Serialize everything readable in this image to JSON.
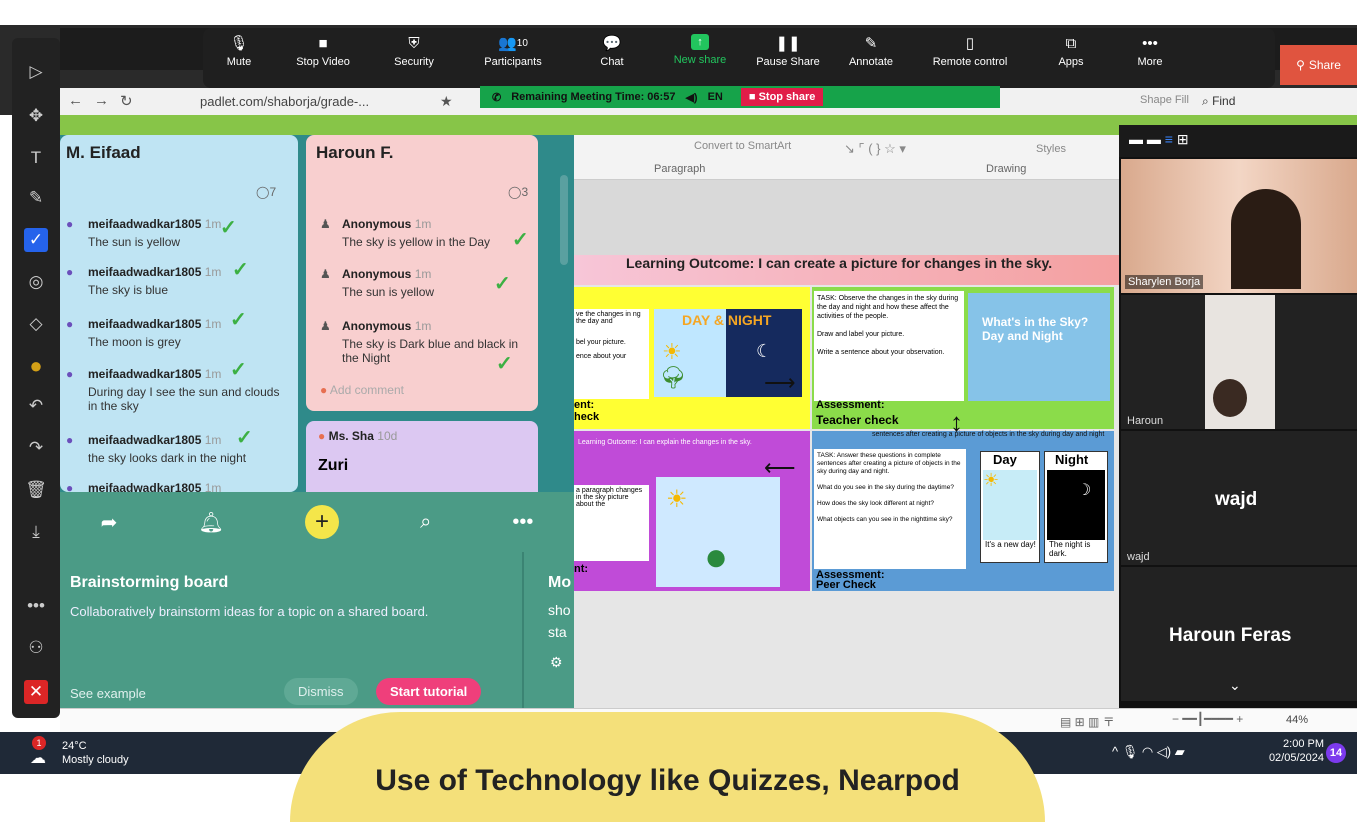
{
  "zoom": {
    "buttons": [
      {
        "label": "Mute",
        "icon": "mic-icon"
      },
      {
        "label": "Stop Video",
        "icon": "video-icon"
      },
      {
        "label": "Security",
        "icon": "shield-icon"
      },
      {
        "label": "Participants",
        "icon": "participants-icon",
        "count": "10"
      },
      {
        "label": "Chat",
        "icon": "chat-icon"
      },
      {
        "label": "New share",
        "icon": "share-icon"
      },
      {
        "label": "Pause Share",
        "icon": "pause-icon"
      },
      {
        "label": "Annotate",
        "icon": "pen-icon"
      },
      {
        "label": "Remote control",
        "icon": "mouse-icon"
      },
      {
        "label": "Apps",
        "icon": "apps-icon"
      },
      {
        "label": "More",
        "icon": "more-icon"
      }
    ],
    "share": "Share",
    "remaining": "Remaining Meeting Time: 06:57",
    "lang": "EN",
    "stop_share": "Stop share"
  },
  "browser": {
    "url": "padlet.com/shaborja/grade-...",
    "find": "Find",
    "shape_fill": "Shape Fill"
  },
  "padlet": {
    "col1": {
      "title": "M. Eifaad",
      "comments": "7",
      "posts": [
        {
          "name": "meifaadwadkar1805",
          "time": "1m",
          "text": "The sun is yellow"
        },
        {
          "name": "meifaadwadkar1805",
          "time": "1m",
          "text": "The sky is blue"
        },
        {
          "name": "meifaadwadkar1805",
          "time": "1m",
          "text": "The moon is grey"
        },
        {
          "name": "meifaadwadkar1805",
          "time": "1m",
          "text": "During day I see the sun and clouds in the sky"
        },
        {
          "name": "meifaadwadkar1805",
          "time": "1m",
          "text": "the sky looks dark in the night"
        },
        {
          "name": "meifaadwadkar1805",
          "time": "1m",
          "text": ""
        }
      ]
    },
    "col2": {
      "title": "Haroun F.",
      "comments": "3",
      "posts": [
        {
          "name": "Anonymous",
          "time": "1m",
          "text": "The sky is yellow in the Day"
        },
        {
          "name": "Anonymous",
          "time": "1m",
          "text": "The sun is yellow"
        },
        {
          "name": "Anonymous",
          "time": "1m",
          "text": "The sky is Dark blue and black in the Night"
        }
      ],
      "add_comment": "Add comment",
      "post2_name": "Ms. Sha",
      "post2_time": "10d",
      "post2_title": "Zuri"
    },
    "tutorial": {
      "title": "Brainstorming board",
      "desc": "Collaboratively brainstorm ideas for a topic on a shared board.",
      "see": "See example",
      "dismiss": "Dismiss",
      "start": "Start tutorial",
      "next_title": "Mo",
      "next_l1": "sho",
      "next_l2": "sta"
    }
  },
  "ppt": {
    "convert": "Convert to SmartArt",
    "paragraph": "Paragraph",
    "drawing": "Drawing",
    "styles": "Styles",
    "lo_title": "Learning Outcome: I can create a picture for changes in the sky.",
    "day_night": "DAY & NIGHT",
    "whats_sky": "What's in the Sky?",
    "day": "Day",
    "and": "and",
    "night": "Night",
    "task1": "TASK: Observe the changes in the sky during the day and night and how these affect the activities of the people.",
    "task1b": "Draw and label your picture.",
    "task1c": "Write a sentence about your observation.",
    "assessment": "Assessment:",
    "teacher_check": "Teacher check",
    "peer_check": "Peer Check",
    "lo2": "Learning Outcome: I can explain the changes in the sky.",
    "task2": "TASK: Answer these questions in complete sentences after creating a picture of objects in the sky during day and night.",
    "q1": "What do you see in the sky during the daytime?",
    "q2": "How does the sky look different at night?",
    "q3": "What objects can you see in the nighttime sky?",
    "new_day": "It's a new day!",
    "night_dark": "The night is dark.",
    "left1": "ve the changes in ng the day and",
    "left2": "bel your picture.",
    "left3": "ence about your",
    "left4": "ent:",
    "left5": "heck",
    "left6": "a paragraph changes in the sky picture about the",
    "left7": "nt:",
    "sentences": "sentences after creating a picture of objects in the sky during day and night",
    "zoom": "44%"
  },
  "video": {
    "p1": "Sharylen Borja",
    "p2": "Haroun",
    "p3": "wajd",
    "p3_small": "wajd",
    "p4": "Haroun Feras"
  },
  "taskbar": {
    "temp": "24°C",
    "weather": "Mostly cloudy",
    "time": "2:00 PM",
    "date": "02/05/2024",
    "notif": "14",
    "badge": "1"
  },
  "caption": "Use of Technology like Quizzes, Nearpod"
}
